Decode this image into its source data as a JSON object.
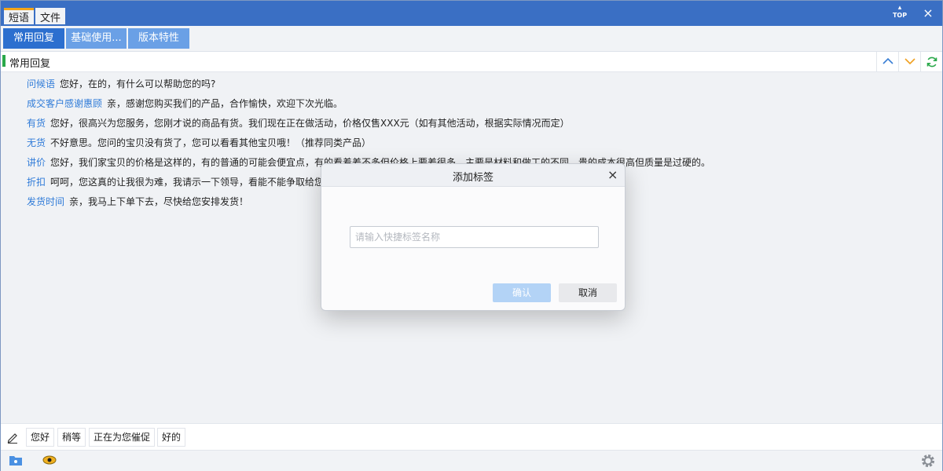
{
  "titlebar": {
    "tabs": [
      {
        "label": "短语",
        "active": true
      },
      {
        "label": "文件",
        "active": false
      }
    ],
    "top_label": "TOP",
    "close_label": "×"
  },
  "categories": [
    {
      "label": "常用回复",
      "active": true
    },
    {
      "label": "基础使用...",
      "active": false
    },
    {
      "label": "版本特性",
      "active": false
    }
  ],
  "group": {
    "title": "常用回复"
  },
  "phrases": [
    {
      "tag": "问候语",
      "text": "您好，在的，有什么可以帮助您的吗?"
    },
    {
      "tag": "成交客户感谢惠顾",
      "text": "亲，感谢您购买我们的产品，合作愉快，欢迎下次光临。"
    },
    {
      "tag": "有货",
      "text": "您好，很高兴为您服务，您刚才说的商品有货。我们现在正在做活动，价格仅售XXX元（如有其他活动，根据实际情况而定）"
    },
    {
      "tag": "无货",
      "text": "不好意思。您问的宝贝没有货了，您可以看看其他宝贝哦！（推荐同类产品）"
    },
    {
      "tag": "讲价",
      "text": "您好，我们家宝贝的价格是这样的，有的普通的可能会便宜点，有的看着差不多但价格上要差很多，主要是材料和做工的不同，贵的成本很高但质量是过硬的。"
    },
    {
      "tag": "折扣",
      "text": "呵呵，您这真的让我很为难，我请示一下领导，看能不能争取给您"
    },
    {
      "tag": "发货时间",
      "text": "亲，我马上下单下去，尽快给您安排发货！"
    }
  ],
  "quick_phrases": [
    "您好",
    "稍等",
    "正在为您催促",
    "好的"
  ],
  "modal": {
    "title": "添加标签",
    "close": "×",
    "input_value": "",
    "input_placeholder": "请输入快捷标签名称",
    "confirm": "确认",
    "cancel": "取消"
  },
  "colors": {
    "titlebar": "#3a6fc4",
    "tab_active_accent": "#f3a51a",
    "category_active": "#2c6fcf",
    "category_inactive": "#6aa0e6",
    "group_mark": "#2aa84a",
    "tag_text": "#2f7bd8",
    "confirm_disabled": "#b3d3f6"
  }
}
